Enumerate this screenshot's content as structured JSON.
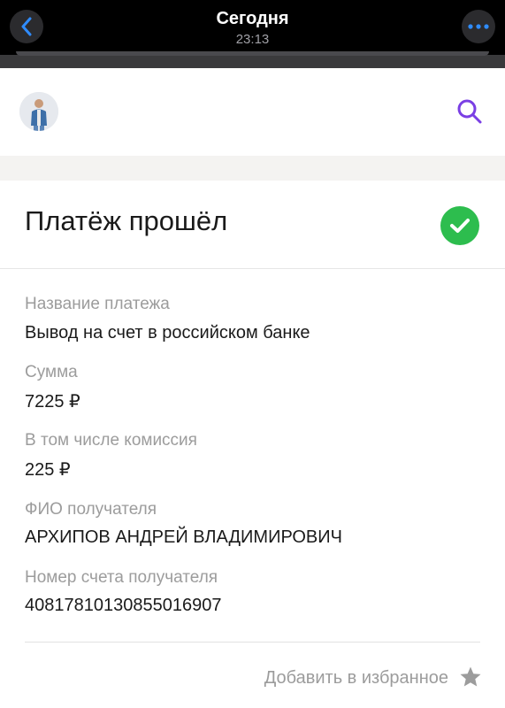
{
  "topbar": {
    "title": "Сегодня",
    "time": "23:13",
    "back_icon": "chevron-left-icon",
    "more_icon": "ellipsis-icon",
    "accent_color": "#2f8cff"
  },
  "header": {
    "avatar_icon": "user-avatar",
    "search_icon": "search-icon",
    "search_color": "#7a3fe4"
  },
  "status": {
    "title": "Платёж прошёл",
    "icon": "check-circle-icon",
    "color": "#2dbd4e"
  },
  "details": [
    {
      "label": "Название платежа",
      "value": "Вывод на счет в российском банке"
    },
    {
      "label": "Сумма",
      "value": "7225 ₽"
    },
    {
      "label": "В том числе комиссия",
      "value": "225 ₽"
    },
    {
      "label": "ФИО получателя",
      "value": "АРХИПОВ АНДРЕЙ ВЛАДИМИРОВИЧ"
    },
    {
      "label": "Номер счета получателя",
      "value": "40817810130855016907"
    }
  ],
  "favorite": {
    "label": "Добавить в избранное",
    "icon": "star-icon"
  }
}
